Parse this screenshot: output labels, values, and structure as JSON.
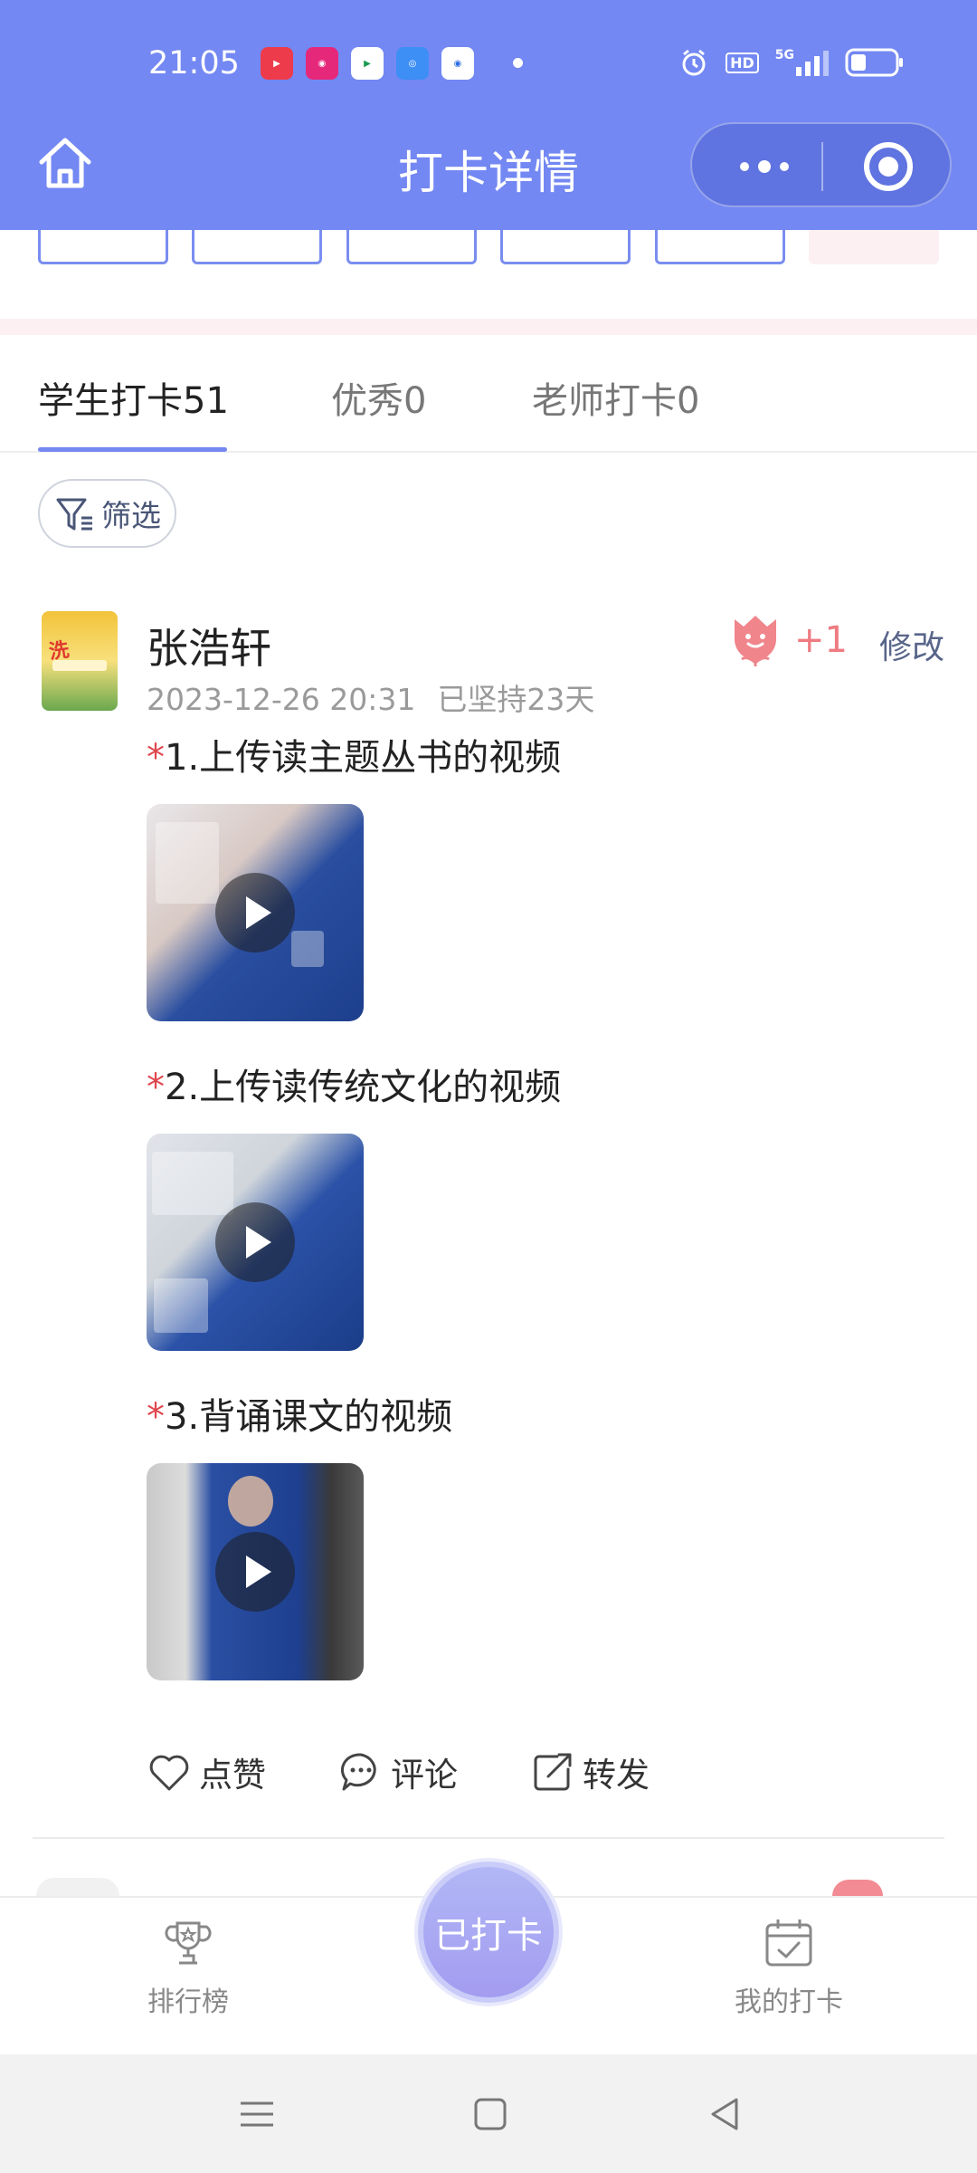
{
  "status_bar": {
    "time": "21:05",
    "network": "5G",
    "hd": "HD",
    "apps": [
      "youtube-icon",
      "app-icon",
      "video-icon",
      "browser-icon",
      "qq-browser-icon"
    ]
  },
  "header": {
    "title": "打卡详情"
  },
  "tabs": [
    {
      "label": "学生打卡51",
      "active": true
    },
    {
      "label": "优秀0",
      "active": false
    },
    {
      "label": "老师打卡0",
      "active": false
    }
  ],
  "filter": {
    "label": "筛选"
  },
  "post": {
    "user_name": "张浩轩",
    "date": "2023-12-26 20:31",
    "streak": "已坚持23天",
    "flower_count": "+1",
    "edit_label": "修改",
    "tasks": [
      {
        "req": "*",
        "title": "1.上传读主题丛书的视频"
      },
      {
        "req": "*",
        "title": "2.上传读传统文化的视频"
      },
      {
        "req": "*",
        "title": "3.背诵课文的视频"
      }
    ],
    "actions": {
      "like": "点赞",
      "comment": "评论",
      "share": "转发"
    }
  },
  "bottom_bar": {
    "ranking": "排行榜",
    "checkin": "已打卡",
    "my_checkin": "我的打卡"
  },
  "colors": {
    "header": "#7388f2",
    "accent": "#7388f2",
    "flower": "#ef7b82",
    "required": "#e0464d"
  }
}
